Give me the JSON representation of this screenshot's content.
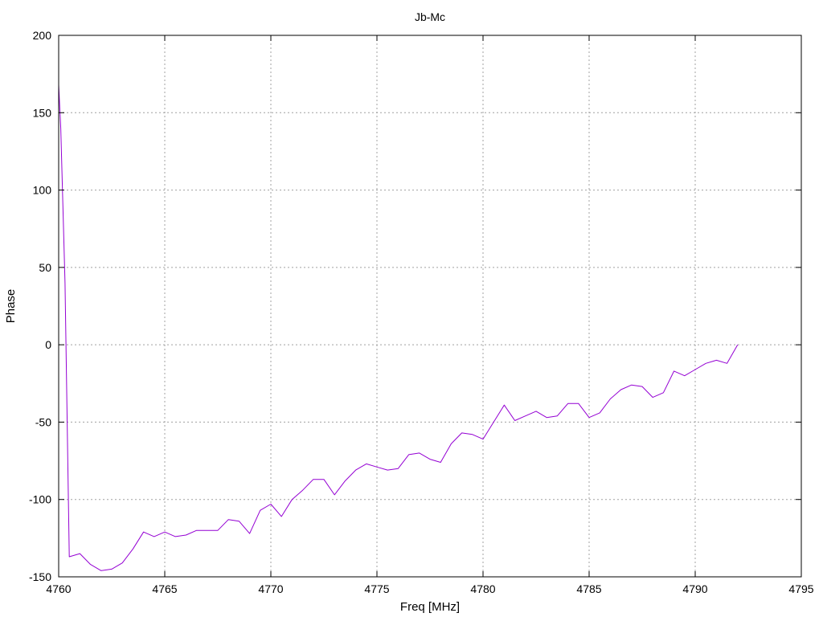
{
  "chart_data": {
    "type": "line",
    "title": "Jb-Mc",
    "xlabel": "Freq [MHz]",
    "ylabel": "Phase",
    "xlim": [
      4760,
      4795
    ],
    "ylim": [
      -150,
      200
    ],
    "xticks": [
      4760,
      4765,
      4770,
      4775,
      4780,
      4785,
      4790,
      4795
    ],
    "yticks": [
      -150,
      -100,
      -50,
      0,
      50,
      100,
      150,
      200
    ],
    "xtick_labels": [
      "4760",
      "4765",
      "4770",
      "4775",
      "4780",
      "4785",
      "4790",
      "4795"
    ],
    "ytick_labels": [
      "-150",
      "-100",
      "-50",
      "0",
      "50",
      "100",
      "150",
      "200"
    ],
    "grid": true,
    "legend": "none",
    "series": [
      {
        "color": "#9400d3",
        "x": [
          4760,
          4760.1,
          4760.3,
          4760.5,
          4761,
          4761.5,
          4762,
          4762.5,
          4763,
          4763.5,
          4764,
          4764.5,
          4765,
          4765.5,
          4766,
          4766.5,
          4767,
          4767.5,
          4768,
          4768.5,
          4769,
          4769.5,
          4770,
          4770.5,
          4771,
          4771.5,
          4772,
          4772.5,
          4773,
          4773.5,
          4774,
          4774.5,
          4775,
          4775.5,
          4776,
          4776.5,
          4777,
          4777.5,
          4778,
          4778.5,
          4779,
          4779.5,
          4780,
          4780.5,
          4781,
          4781.5,
          4782,
          4782.5,
          4783,
          4783.5,
          4784,
          4784.5,
          4785,
          4785.5,
          4786,
          4786.5,
          4787,
          4787.5,
          4788,
          4788.5,
          4789,
          4789.5,
          4790,
          4790.5,
          4791,
          4791.5,
          4792
        ],
        "y": [
          168,
          140,
          40,
          -137,
          -135,
          -142,
          -146,
          -145,
          -141,
          -132,
          -121,
          -124,
          -121,
          -124,
          -123,
          -120,
          -120,
          -120,
          -113,
          -114,
          -122,
          -107,
          -103,
          -111,
          -100,
          -94,
          -87,
          -87,
          -97,
          -88,
          -81,
          -77,
          -79,
          -81,
          -80,
          -71,
          -70,
          -74,
          -76,
          -64,
          -57,
          -58,
          -61,
          -50,
          -39,
          -49,
          -46,
          -43,
          -47,
          -46,
          -38,
          -38,
          -47,
          -44,
          -35,
          -29,
          -26,
          -27,
          -34,
          -31,
          -17,
          -20,
          -16,
          -12,
          -10,
          -12,
          0
        ]
      }
    ]
  }
}
